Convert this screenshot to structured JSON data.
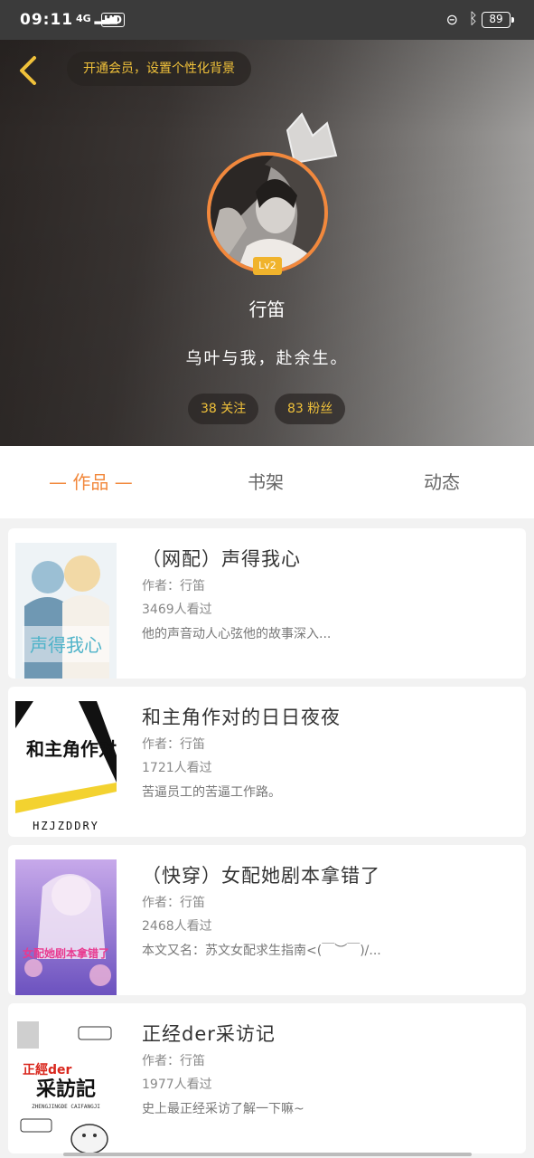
{
  "status_bar": {
    "time": "09:11",
    "network": "4G",
    "hd": "HD",
    "battery": "89"
  },
  "header": {
    "vip_banner": "开通会员，设置个性化背景",
    "level": "Lv2",
    "username": "行笛",
    "signature": "乌叶与我，赴余生。",
    "following": "38 关注",
    "fans": "83 粉丝"
  },
  "tabs": [
    {
      "label": "— 作品 —"
    },
    {
      "label": "书架"
    },
    {
      "label": "动态"
    }
  ],
  "works": [
    {
      "title": "（网配）声得我心",
      "author": "作者：行笛",
      "views": "3469人看过",
      "desc": "他的声音动人心弦他的故事深入...",
      "cover_text": "声得我心",
      "cover_colors": [
        "#e7eef2",
        "#8fc0d8",
        "#f3d9c4"
      ]
    },
    {
      "title": "和主角作对的日日夜夜",
      "author": "作者：行笛",
      "views": "1721人看过",
      "desc": "苦逼员工的苦逼工作路。",
      "cover_text": "和主角作对",
      "cover_sub": "HZJZDDRY",
      "cover_colors": [
        "#ffffff",
        "#f3d230",
        "#111111"
      ]
    },
    {
      "title": "（快穿）女配她剧本拿错了",
      "author": "作者：行笛",
      "views": "2468人看过",
      "desc": "本文又名：苏文女配求生指南<(￣︶￣)/...",
      "cover_text": "女配她剧本拿错了",
      "cover_colors": [
        "#c9a6e6",
        "#7a5cc4",
        "#f7d7ef"
      ]
    },
    {
      "title": "正经der采访记",
      "author": "作者：行笛",
      "views": "1977人看过",
      "desc": "史上最正经采访了解一下嘛~",
      "cover_text": "采訪記",
      "cover_badge": "正經der",
      "cover_sub": "ZHENGJINGDE CAIFANGJI",
      "cover_colors": [
        "#ffffff",
        "#d9261c",
        "#222222"
      ]
    }
  ],
  "colors": {
    "accent": "#f2883c",
    "gold": "#f0c13a",
    "level": "#f0b32c"
  }
}
